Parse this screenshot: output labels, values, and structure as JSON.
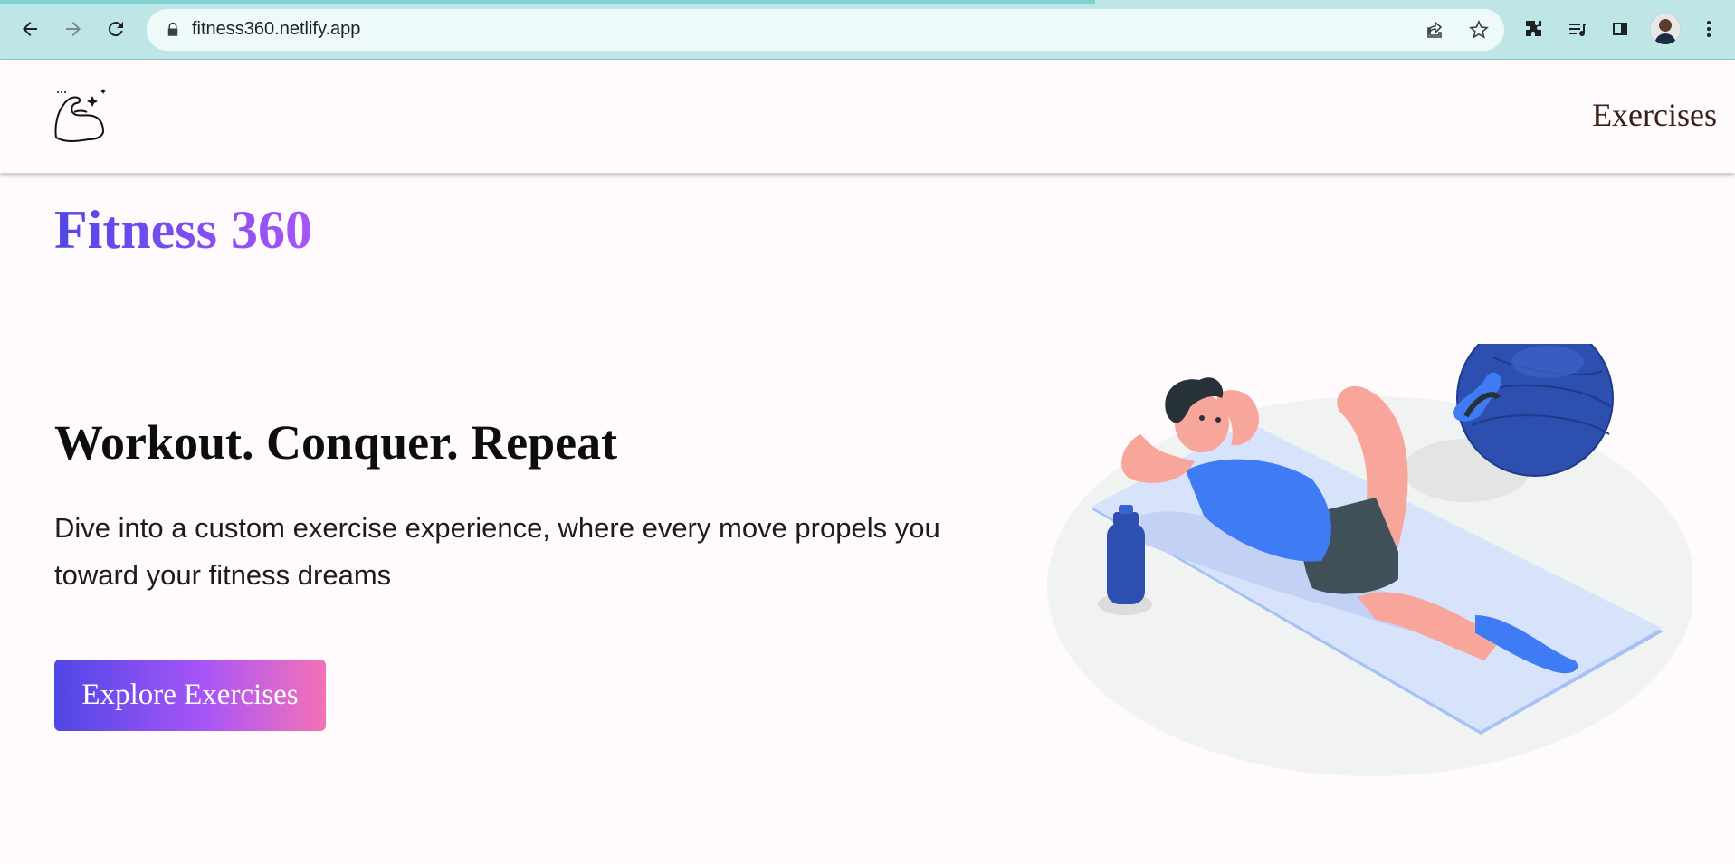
{
  "browser": {
    "url": "fitness360.netlify.app",
    "icons": [
      "back-icon",
      "forward-icon",
      "reload-icon",
      "lock-icon",
      "share-icon",
      "star-icon",
      "extensions-icon",
      "media-icon",
      "sidepanel-icon",
      "profile-avatar",
      "menu-icon"
    ]
  },
  "nav": {
    "logo_icon": "flexed-arm-icon",
    "exercises_link": "Exercises"
  },
  "hero": {
    "brand": "Fitness 360",
    "headline": "Workout. Conquer. Repeat",
    "description": "Dive into a custom exercise experience, where every move propels you toward your fitness dreams",
    "cta_label": "Explore Exercises",
    "illustration": "person-doing-crunches-illustration"
  },
  "colors": {
    "accent_start": "#4f46e5",
    "accent_mid": "#a855f7",
    "accent_end": "#f472b6",
    "chrome_bg": "#bfe6e6"
  }
}
